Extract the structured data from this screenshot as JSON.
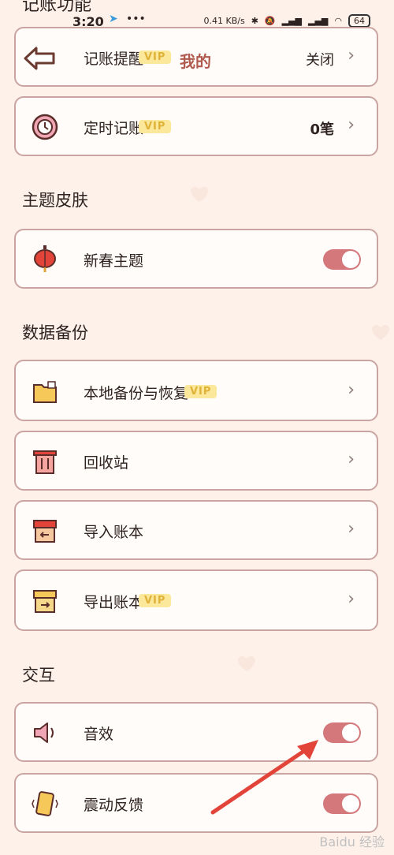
{
  "status_bar": {
    "time": "3:20",
    "speed": "0.41 KB/s",
    "battery": "64"
  },
  "top_section_label": "记账功能",
  "overlay_text": "我的",
  "accounting": {
    "reminder": {
      "label": "记账提醒",
      "vip": "VIP",
      "value": "关闭"
    },
    "scheduled": {
      "label": "定时记账",
      "vip": "VIP",
      "value": "0笔"
    }
  },
  "theme_section": {
    "title": "主题皮肤",
    "item": {
      "label": "新春主题"
    }
  },
  "backup_section": {
    "title": "数据备份",
    "items": [
      {
        "label": "本地备份与恢复",
        "vip": "VIP"
      },
      {
        "label": "回收站"
      },
      {
        "label": "导入账本"
      },
      {
        "label": "导出账本",
        "vip": "VIP"
      }
    ]
  },
  "interaction_section": {
    "title": "交互",
    "items": [
      {
        "label": "音效"
      },
      {
        "label": "震动反馈"
      }
    ]
  },
  "watermark": "Baidu 经验",
  "colors": {
    "toggle_on": "#d4787c",
    "card_border": "#c9a4a0",
    "vip_bg": "#fbe89a",
    "arrow": "#e2443a"
  }
}
